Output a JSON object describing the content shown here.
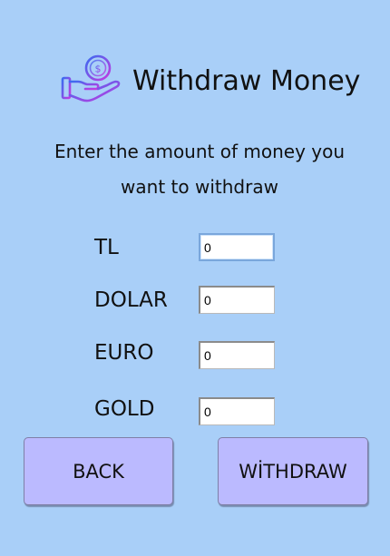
{
  "header": {
    "title": "Withdraw Money",
    "icon": "hand-money-coin-icon"
  },
  "instruction": "Enter the amount of money you want to withdraw",
  "fields": [
    {
      "label": "TL",
      "value": "0"
    },
    {
      "label": "DOLAR",
      "value": "0"
    },
    {
      "label": "EURO",
      "value": "0"
    },
    {
      "label": "GOLD",
      "value": "0"
    }
  ],
  "buttons": {
    "back_label": "BACK",
    "withdraw_label": "WİTHDRAW"
  },
  "colors": {
    "background": "#a9cff8",
    "button": "#bbbaff",
    "icon_gradient_start": "#3a6cf0",
    "icon_gradient_end": "#c53ae0"
  }
}
